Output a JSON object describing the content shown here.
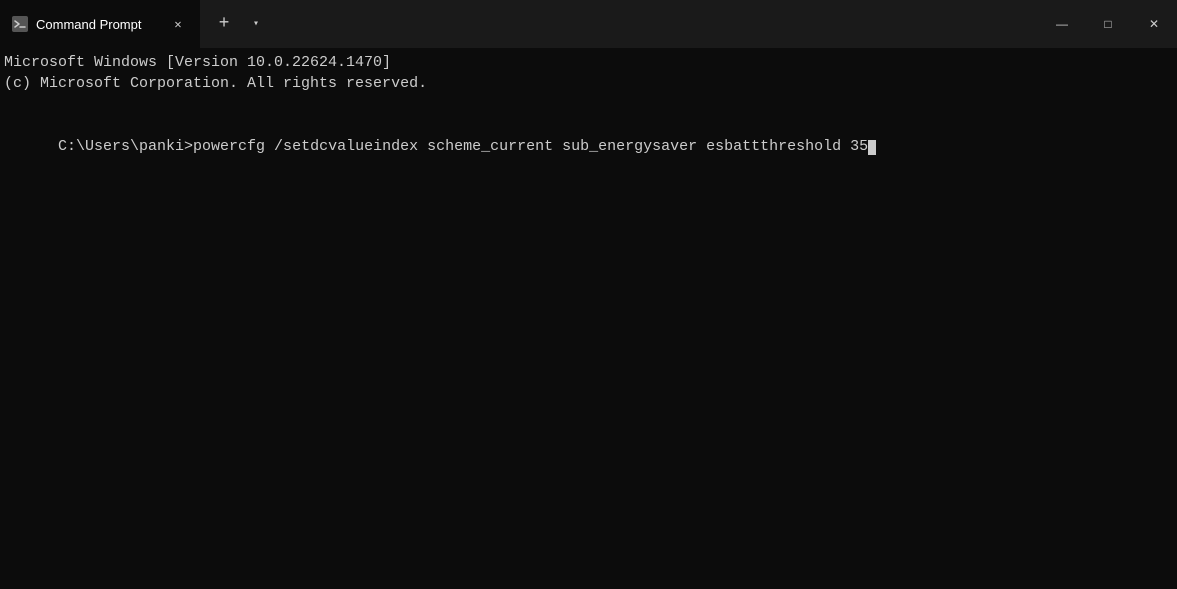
{
  "titlebar": {
    "tab_title": "Command Prompt",
    "new_tab_label": "+",
    "dropdown_label": "▾"
  },
  "window_controls": {
    "minimize": "—",
    "maximize": "□",
    "close": "✕"
  },
  "terminal": {
    "line1": "Microsoft Windows [Version 10.0.22624.1470]",
    "line2": "(c) Microsoft Corporation. All rights reserved.",
    "line3": "",
    "prompt": "C:\\Users\\panki>",
    "command": "powercfg /setdcvalueindex scheme_current sub_energysaver esbattthreshold 35"
  }
}
